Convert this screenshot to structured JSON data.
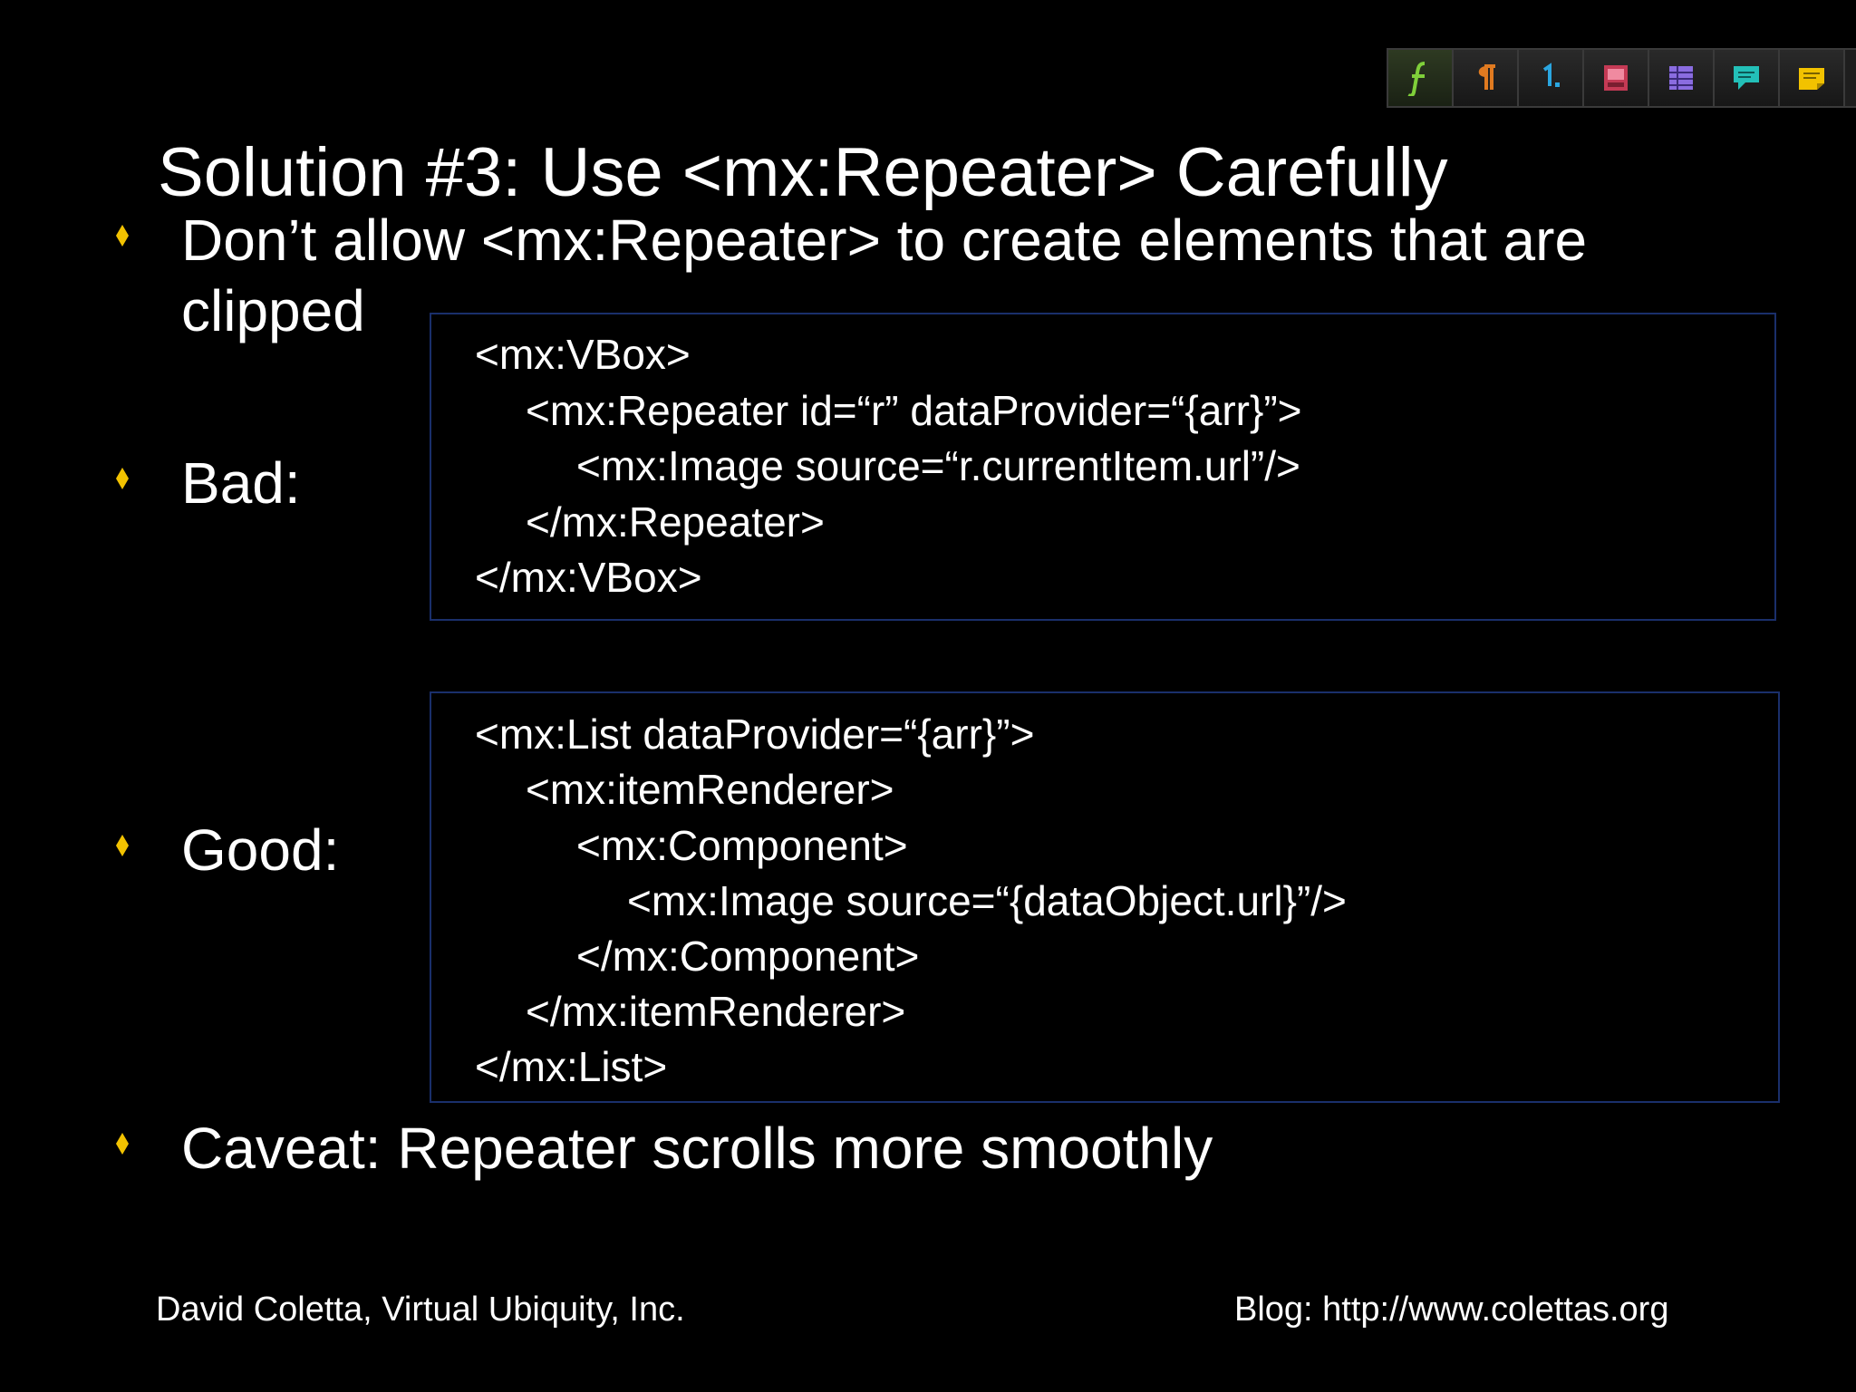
{
  "toolbar": {
    "buttons": [
      {
        "icon": "formula-icon",
        "color": "#7fcf3a"
      },
      {
        "icon": "pilcrow-icon",
        "color": "#e07a20"
      },
      {
        "icon": "numbered-list-icon",
        "color": "#2aa6e0"
      },
      {
        "icon": "picture-icon",
        "color": "#e0506a"
      },
      {
        "icon": "table-icon",
        "color": "#8a6ce0"
      },
      {
        "icon": "comment-icon",
        "color": "#23c0b8"
      },
      {
        "icon": "note-icon",
        "color": "#f2c200"
      }
    ]
  },
  "slide": {
    "title": "Solution #3: Use <mx:Repeater> Carefully",
    "bullets": [
      {
        "line1": "Don’t allow <mx:Repeater> to create elements that are",
        "line2": "clipped"
      },
      {
        "text": "Bad:"
      },
      {
        "text": "Good:"
      },
      {
        "text": "Caveat: Repeater scrolls more smoothly"
      }
    ],
    "bullet_color": "#f2c200",
    "code_bad": [
      "<mx:VBox>",
      "<mx:Repeater id=“r” dataProvider=“{arr}”>",
      "<mx:Image source=“r.currentItem.url”/>",
      "</mx:Repeater>",
      "</mx:VBox>"
    ],
    "code_good": [
      "<mx:List dataProvider=“{arr}”>",
      "<mx:itemRenderer>",
      "<mx:Component>",
      "<mx:Image source=“{dataObject.url}”/>",
      "</mx:Component>",
      "</mx:itemRenderer>",
      "</mx:List>"
    ],
    "box_border_color": "#1a2f6b"
  },
  "footer": {
    "left": "David Coletta, Virtual Ubiquity, Inc.",
    "right": "Blog: http://www.colettas.org"
  }
}
